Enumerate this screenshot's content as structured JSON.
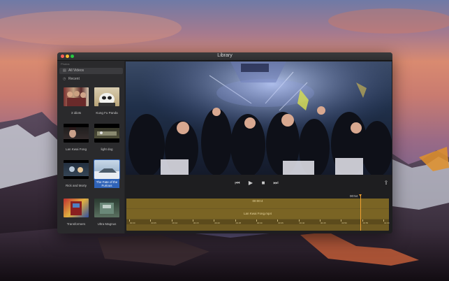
{
  "window": {
    "title": "Library"
  },
  "sidebar": {
    "header": "Photos",
    "items": [
      {
        "label": "All Videos",
        "icon": "film-icon",
        "active": true
      },
      {
        "label": "Recent",
        "icon": "clock-icon",
        "active": false
      }
    ],
    "thumbnails": [
      {
        "caption": "3 idiots",
        "selected": false
      },
      {
        "caption": "Kung Fu Panda",
        "selected": false
      },
      {
        "caption": "Lan Kwai Fong",
        "selected": false
      },
      {
        "caption": "light dog",
        "selected": false
      },
      {
        "caption": "Rick and Morty",
        "selected": false
      },
      {
        "caption": "The Fate of the Furious",
        "selected": true
      },
      {
        "caption": "Transformers",
        "selected": false
      },
      {
        "caption": "Ultra Magnus",
        "selected": false
      }
    ]
  },
  "player": {
    "time": "00:54",
    "controls": [
      "skip-back",
      "play",
      "stop",
      "skip-forward",
      "share"
    ],
    "timeline": {
      "lane_top": "00:00:4",
      "lane_bottom": "Lan Kwai Fong.mp4",
      "ruler": [
        "00:00",
        "00:05",
        "00:10",
        "00:15",
        "00:20",
        "00:25",
        "00:30",
        "00:35",
        "00:40",
        "00:45",
        "00:50",
        "00:55",
        "01:00"
      ]
    }
  }
}
